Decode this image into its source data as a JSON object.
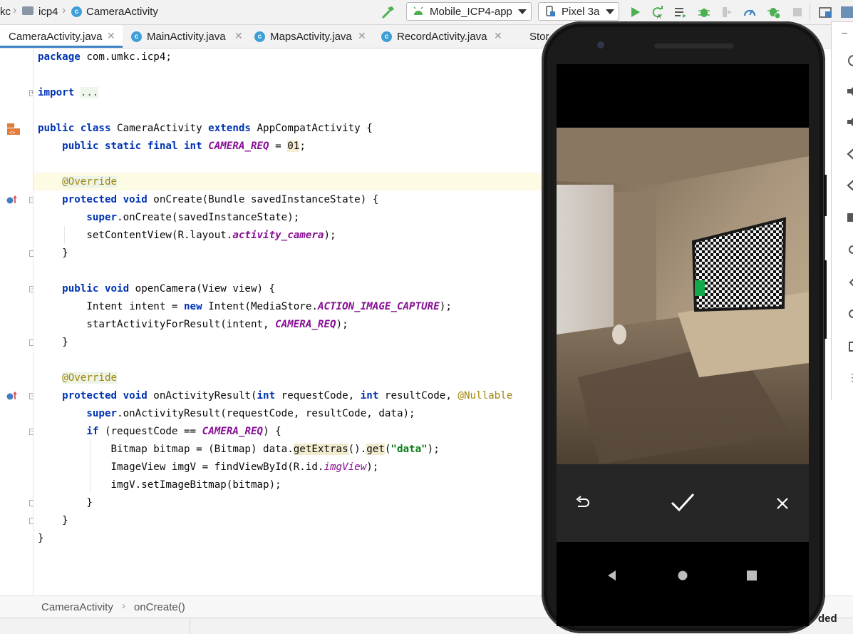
{
  "toolbar": {
    "breadcrumb": [
      "kc",
      "icp4",
      "CameraActivity"
    ],
    "run_config": "Mobile_ICP4-app",
    "device": "Pixel 3a"
  },
  "tabs": [
    {
      "label": "CameraActivity.java",
      "active": true
    },
    {
      "label": "MainActivity.java",
      "active": false
    },
    {
      "label": "MapsActivity.java",
      "active": false
    },
    {
      "label": "RecordActivity.java",
      "active": false
    },
    {
      "label": "Stor",
      "active": false
    }
  ],
  "code": {
    "l1": {
      "a": "package",
      "b": " com.umkc.icp4;"
    },
    "l3": {
      "a": "import",
      "b": " ",
      "c": "..."
    },
    "l5": {
      "a": "public class",
      "b": " CameraActivity ",
      "c": "extends",
      "d": " AppCompatActivity {"
    },
    "l6": {
      "a": "public static final int",
      "b": " ",
      "c": "CAMERA_REQ",
      "d": " = ",
      "e": "01",
      "f": ";"
    },
    "l8": {
      "a": "@Override"
    },
    "l9": {
      "a": "protected void",
      "b": " onCreate(Bundle savedInstanceState) {"
    },
    "l10": {
      "a": "super",
      "b": ".onCreate(savedInstanceState);"
    },
    "l11": {
      "a": "setContentView(R.layout.",
      "b": "activity_camera",
      "c": ");"
    },
    "l12": {
      "a": "}"
    },
    "l14": {
      "a": "public void",
      "b": " openCamera(View view) {"
    },
    "l15": {
      "a": "Intent intent = ",
      "b": "new",
      "c": " Intent(MediaStore.",
      "d": "ACTION_IMAGE_CAPTURE",
      "e": ");"
    },
    "l16": {
      "a": "startActivityForResult(intent, ",
      "b": "CAMERA_REQ",
      "c": ");"
    },
    "l17": {
      "a": "}"
    },
    "l19": {
      "a": "@Override"
    },
    "l20": {
      "a": "protected void",
      "b": " onActivityResult(",
      "c": "int",
      "d": " requestCode, ",
      "e": "int",
      "f": " resultCode, ",
      "g": "@Nullable"
    },
    "l21": {
      "a": "super",
      "b": ".onActivityResult(requestCode, resultCode, data);"
    },
    "l22": {
      "a": "if",
      "b": " (requestCode == ",
      "c": "CAMERA_REQ",
      "d": ") {"
    },
    "l23": {
      "a": "Bitmap bitmap = (Bitmap) data.",
      "b": "getExtras",
      "c": "().",
      "d": "get",
      "e": "(",
      "f": "\"data\"",
      "g": ");"
    },
    "l24": {
      "a": "ImageView imgV = findViewById(R.id.",
      "b": "imgView",
      "c": ");"
    },
    "l25": {
      "a": "imgV.setImageBitmap(bitmap);"
    },
    "l26": {
      "a": "}"
    },
    "l27": {
      "a": "}"
    },
    "l28": {
      "a": "}"
    }
  },
  "breadcrumb_bar": {
    "class_name": "CameraActivity",
    "method_name": "onCreate()"
  },
  "status_fragment": "ded",
  "colors": {
    "accent": "#4083c9",
    "run_green": "#4caf50",
    "keyword": "#0033b3",
    "constant": "#871094",
    "string": "#067d17"
  }
}
